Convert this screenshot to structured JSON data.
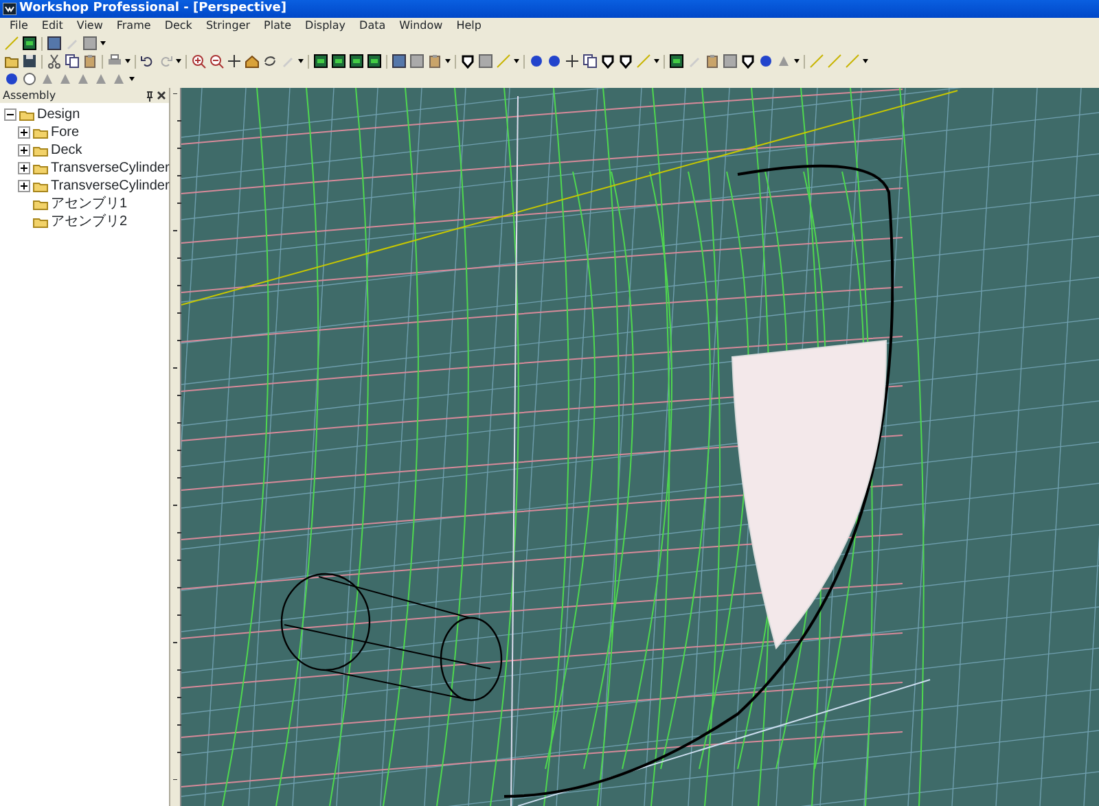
{
  "window": {
    "title": "Workshop Professional - [Perspective]"
  },
  "menu": [
    "File",
    "Edit",
    "View",
    "Frame",
    "Deck",
    "Stringer",
    "Plate",
    "Display",
    "Data",
    "Window",
    "Help"
  ],
  "assembly_panel": {
    "title": "Assembly",
    "tree": [
      {
        "label": "Design",
        "expanded": true,
        "children": [
          {
            "label": "Fore",
            "expanded": false
          },
          {
            "label": "Deck",
            "expanded": false
          },
          {
            "label": "TransverseCylinder",
            "expanded": false
          },
          {
            "label": "TransverseCylinder",
            "expanded": false
          },
          {
            "label": "アセンブリ1"
          },
          {
            "label": "アセンブリ2"
          }
        ]
      }
    ]
  }
}
